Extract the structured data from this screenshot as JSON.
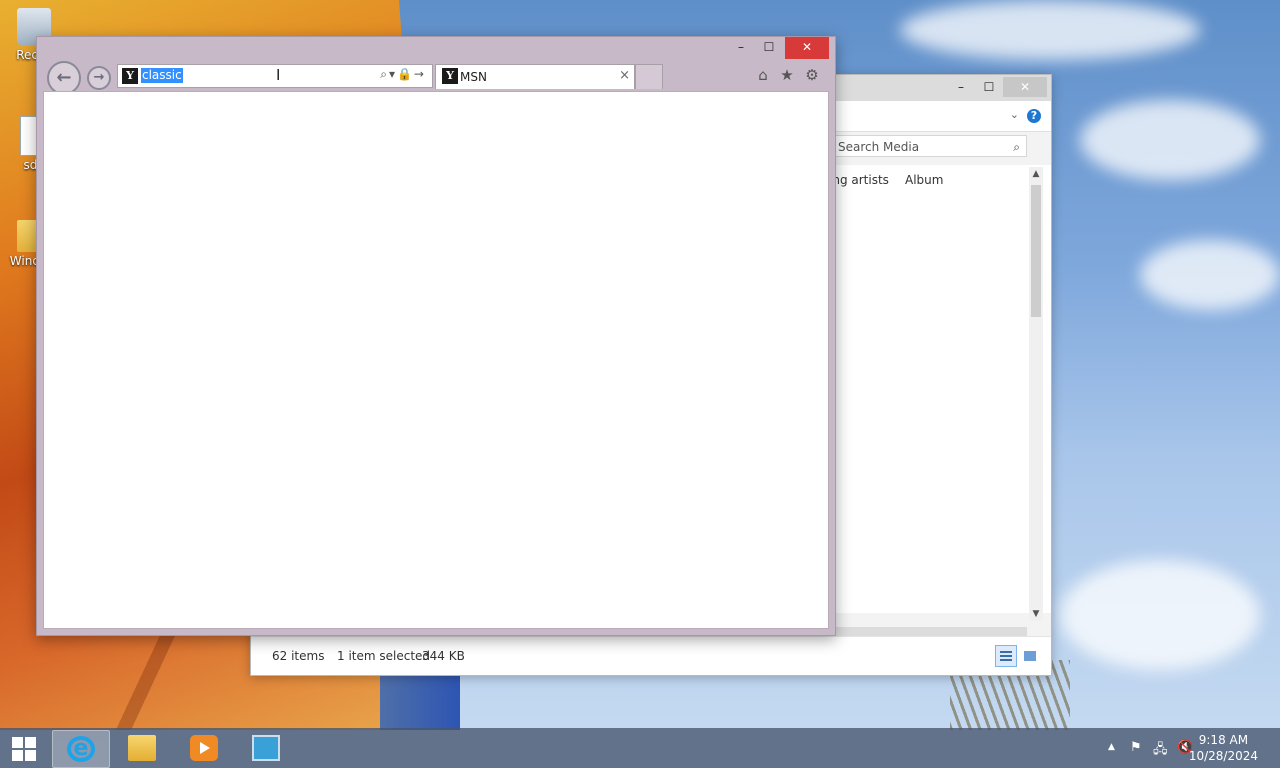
{
  "desktop": {
    "icons": [
      {
        "label": "Recyc",
        "icon": "recycle-bin-icon"
      },
      {
        "label": "sdf.",
        "icon": "document-icon"
      },
      {
        "label": "Wind av",
        "icon": "folder-icon"
      }
    ]
  },
  "media_window": {
    "controls": {
      "minimize": "–",
      "maximize": "☐",
      "close": "✕"
    },
    "search_placeholder": "Search Media",
    "columns": [
      "ing artists",
      "Album"
    ],
    "status": {
      "items": "62 items",
      "selected": "1 item selected",
      "size": "344 KB"
    }
  },
  "browser": {
    "controls": {
      "minimize": "–",
      "maximize": "☐",
      "close": "✕"
    },
    "nav": {
      "back": "←",
      "forward": "→"
    },
    "address": {
      "value": "classic",
      "site_icon": "Y",
      "tools": "⌕▾🔒→"
    },
    "tab": {
      "title": "MSN",
      "site_icon": "Y",
      "close": "×"
    },
    "commands": {
      "home": "⌂",
      "favorites": "★",
      "settings": "⚙"
    }
  },
  "taskbar": {
    "apps": [
      {
        "name": "Internet Explorer",
        "icon": "internet-explorer-icon",
        "active": true
      },
      {
        "name": "File Explorer",
        "icon": "file-explorer-icon",
        "active": false
      },
      {
        "name": "Windows Media Player",
        "icon": "media-player-icon",
        "active": false
      },
      {
        "name": "Control Panel",
        "icon": "control-panel-icon",
        "active": false
      }
    ],
    "tray": {
      "show_hidden": "▲",
      "flag": "⚑",
      "network": "🖧",
      "volume": "🔇"
    },
    "clock": {
      "time": "9:18 AM",
      "date": "10/28/2024"
    }
  },
  "colors": {
    "ie_frame": "#c8b9c8",
    "close_red": "#d83a3a",
    "selection_blue": "#3390ff",
    "accent_blue": "#1e78d2"
  }
}
